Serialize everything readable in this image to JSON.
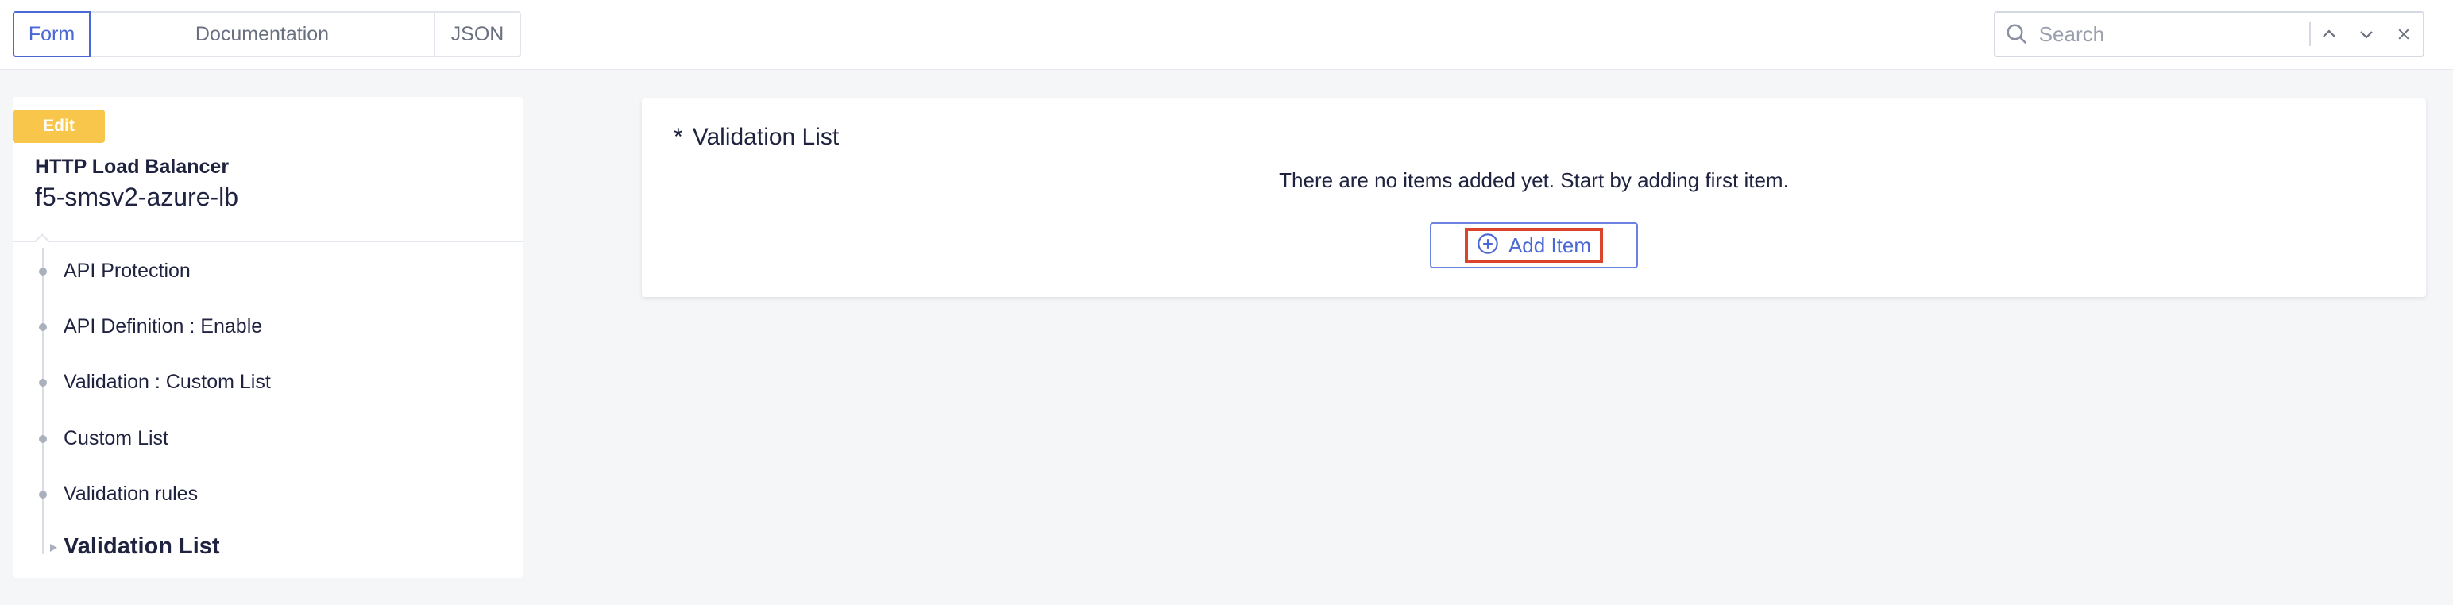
{
  "tabs": {
    "form": "Form",
    "documentation": "Documentation",
    "json": "JSON"
  },
  "search": {
    "placeholder": "Search"
  },
  "sidebar": {
    "badge": "Edit",
    "object_type": "HTTP Load Balancer",
    "object_name": "f5-smsv2-azure-lb",
    "breadcrumbs": [
      "API Protection",
      "API Definition : Enable",
      "Validation : Custom List",
      "Custom List",
      "Validation rules"
    ],
    "current": "Validation List"
  },
  "main": {
    "required_mark": "*",
    "title": "Validation List",
    "empty_message": "There are no items added yet. Start by adding first item.",
    "add_button": "Add Item"
  },
  "colors": {
    "accent": "#4a67d6",
    "badge": "#f7c64a",
    "highlight": "#d9442b"
  }
}
